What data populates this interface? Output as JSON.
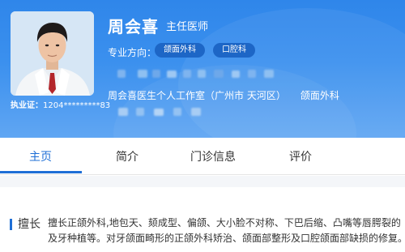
{
  "doctor": {
    "name": "周会喜",
    "title": "主任医师",
    "license_label": "执业证：",
    "license_number": "1204*********83",
    "specialty_label": "专业方向：",
    "specialties": [
      "颌面外科",
      "口腔科"
    ],
    "studio": "周会喜医生个人工作室",
    "location": "（广州市 天河区）",
    "department": "颌面外科"
  },
  "tabs": [
    {
      "label": "主页",
      "active": true
    },
    {
      "label": "简介",
      "active": false
    },
    {
      "label": "门诊信息",
      "active": false
    },
    {
      "label": "评价",
      "active": false
    }
  ],
  "expertise": {
    "label": "擅长",
    "line1": "擅长正颌外科,地包天、颏成型、偏颌、大小脸不对称、下巴后缩、凸嘴等唇腭裂的",
    "line2": "及牙种植等。对牙颌面畸形的正颌外科矫治、颌面部整形及口腔颌面部缺损的修复。"
  },
  "colors": {
    "header_blue": "#2f86ea",
    "chip_blue": "#1d66c6",
    "accent_blue": "#1f6fd6"
  }
}
